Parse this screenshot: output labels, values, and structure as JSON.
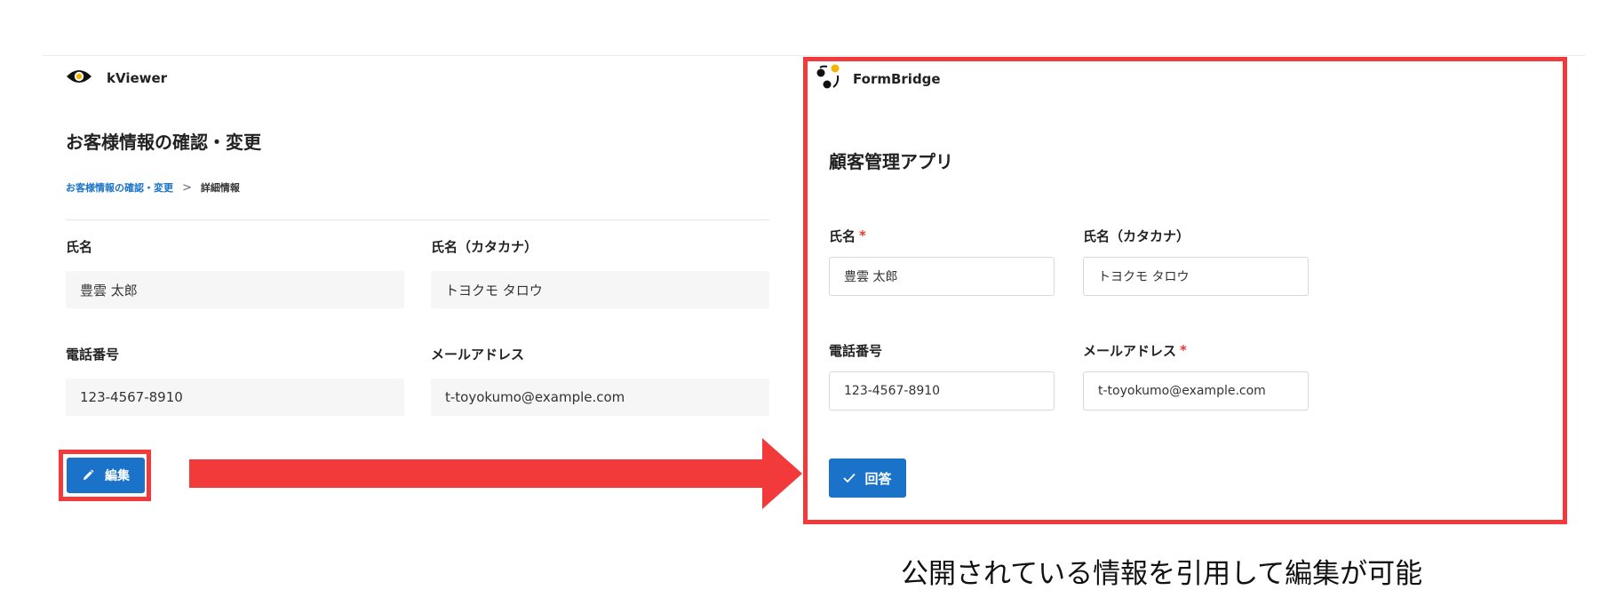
{
  "kviewer": {
    "brand": "kViewer",
    "page_title": "お客様情報の確認・変更",
    "breadcrumb": {
      "link": "お客様情報の確認・変更",
      "separator": ">",
      "current": "詳細情報"
    },
    "fields": [
      {
        "label": "氏名",
        "value": "豊雲 太郎"
      },
      {
        "label": "氏名（カタカナ）",
        "value": "トヨクモ タロウ"
      },
      {
        "label": "電話番号",
        "value": "123-4567-8910"
      },
      {
        "label": "メールアドレス",
        "value": "t-toyokumo@example.com"
      }
    ],
    "edit_button": "編集",
    "icons": {
      "brand": "eye-icon",
      "edit": "pencil-icon"
    }
  },
  "formbridge": {
    "brand": "FormBridge",
    "app_title": "顧客管理アプリ",
    "required_mark": "*",
    "fields": [
      {
        "label": "氏名",
        "required": true,
        "value": "豊雲 太郎"
      },
      {
        "label": "氏名（カタカナ）",
        "required": false,
        "value": "トヨクモ タロウ"
      },
      {
        "label": "電話番号",
        "required": false,
        "value": "123-4567-8910"
      },
      {
        "label": "メールアドレス",
        "required": true,
        "value": "t-toyokumo@example.com"
      }
    ],
    "submit_button": "回答",
    "icons": {
      "brand": "formbridge-logo-icon",
      "submit": "check-icon"
    }
  },
  "caption": "公開されている情報を引用して編集が可能",
  "colors": {
    "accent": "#1a73c8",
    "highlight": "#f23a3a",
    "required": "#e53935",
    "logo_yellow": "#f5b400"
  }
}
